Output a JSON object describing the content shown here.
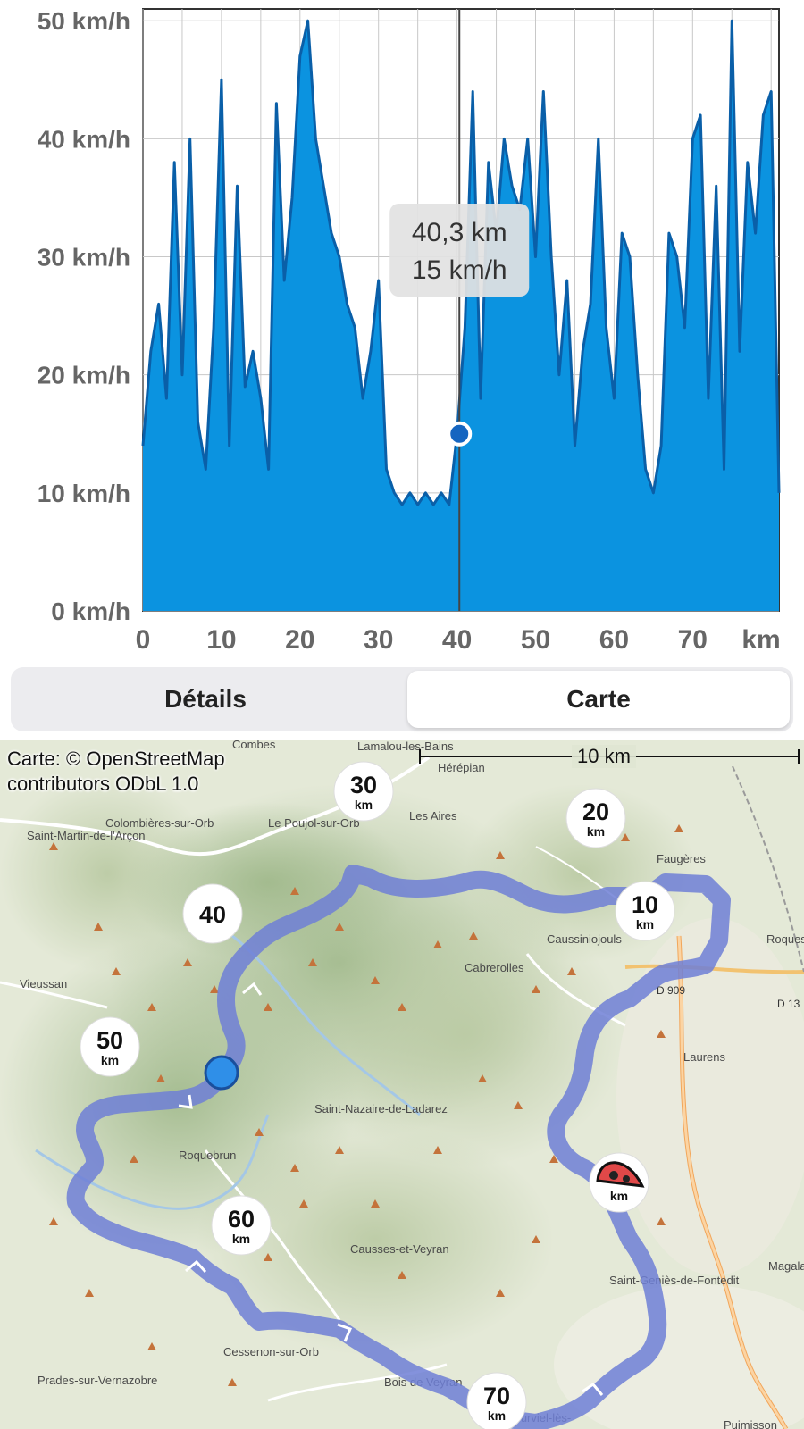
{
  "chart_data": {
    "type": "area",
    "title": "",
    "xlabel": "",
    "ylabel": "",
    "x_unit": "km",
    "y_unit": "km/h",
    "xlim": [
      0,
      81
    ],
    "ylim": [
      0,
      51
    ],
    "x_ticks": [
      "0",
      "10",
      "20",
      "30",
      "40",
      "50",
      "60",
      "70",
      "km"
    ],
    "y_ticks": [
      "0 km/h",
      "10 km/h",
      "20 km/h",
      "30 km/h",
      "40 km/h",
      "50 km/h"
    ],
    "grid": true,
    "series": [
      {
        "x": [
          0,
          1,
          2,
          3,
          4,
          5,
          6,
          7,
          8,
          9,
          10,
          11,
          12,
          13,
          14,
          15,
          16,
          17,
          18,
          19,
          20,
          21,
          22,
          23,
          24,
          25,
          26,
          27,
          28,
          29,
          30,
          31,
          32,
          33,
          34,
          35,
          36,
          37,
          38,
          39,
          40,
          41,
          42,
          43,
          44,
          45,
          46,
          47,
          48,
          49,
          50,
          51,
          52,
          53,
          54,
          55,
          56,
          57,
          58,
          59,
          60,
          61,
          62,
          63,
          64,
          65,
          66,
          67,
          68,
          69,
          70,
          71,
          72,
          73,
          74,
          75,
          76,
          77,
          78,
          79,
          80,
          81
        ],
        "y": [
          14,
          22,
          26,
          18,
          38,
          20,
          40,
          16,
          12,
          24,
          45,
          14,
          36,
          19,
          22,
          18,
          12,
          43,
          28,
          35,
          47,
          50,
          40,
          36,
          32,
          30,
          26,
          24,
          18,
          22,
          28,
          12,
          10,
          9,
          10,
          9,
          10,
          9,
          10,
          9,
          15,
          24,
          44,
          18,
          38,
          32,
          40,
          36,
          34,
          40,
          30,
          44,
          30,
          20,
          28,
          14,
          22,
          26,
          40,
          24,
          18,
          32,
          30,
          20,
          12,
          10,
          14,
          32,
          30,
          24,
          40,
          42,
          18,
          36,
          12,
          50,
          22,
          38,
          32,
          42,
          44,
          10
        ]
      }
    ],
    "cursor": {
      "x": 40.3,
      "y": 15,
      "label_distance": "40,3 km",
      "label_speed": "15 km/h"
    }
  },
  "tabs": {
    "details": "Détails",
    "map": "Carte",
    "selected": "map"
  },
  "map": {
    "attribution_line1": "Carte: © OpenStreetMap",
    "attribution_line2": "contributors ODbL 1.0",
    "scale_label": "10 km",
    "markers": [
      {
        "num": "30",
        "unit": "km"
      },
      {
        "num": "20",
        "unit": "km"
      },
      {
        "num": "10",
        "unit": "km"
      },
      {
        "num": "40",
        "unit": ""
      },
      {
        "num": "50",
        "unit": "km"
      },
      {
        "num": "60",
        "unit": "km"
      },
      {
        "num": "70",
        "unit": "km"
      },
      {
        "num": "",
        "unit": "km"
      }
    ],
    "places": [
      "Combes",
      "Lamalou-les-Bains",
      "Hérépian",
      "Colombières-sur-Orb",
      "Saint-Martin-de-l'Arçon",
      "Le Poujol-sur-Orb",
      "Les Aires",
      "Faugères",
      "Caussiniojouls",
      "Cabrerolles",
      "Vieussan",
      "D 909",
      "D 13",
      "Laurens",
      "Roquess",
      "Saint-Nazaire-de-Ladarez",
      "Roquebrun",
      "Causses-et-Veyran",
      "Saint-Geniès-de-Fontedit",
      "Magala",
      "Cessenon-sur-Orb",
      "Prades-sur-Vernazobre",
      "Bois de Veyran",
      "Murviel-lès-",
      "Puimisson"
    ],
    "colors": {
      "route": "#6e7fd6",
      "position_dot": "#2f8fe8",
      "start_marker": "#e04848",
      "terrain": "#cfdcb8"
    }
  },
  "colors": {
    "area_fill": "#0b93e0",
    "line": "#0a5fa8",
    "grid": "#c8c8c8",
    "cursor_dot": "#1565c0"
  }
}
